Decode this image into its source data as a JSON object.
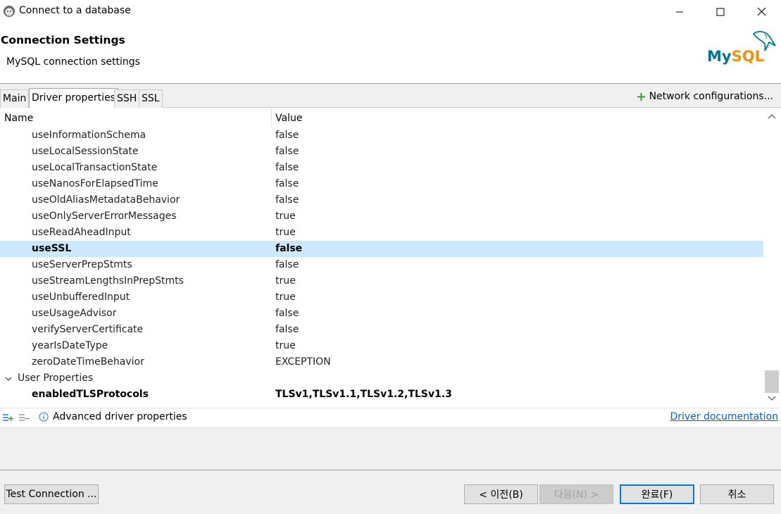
{
  "window": {
    "title": "Connect to a database"
  },
  "header": {
    "title": "Connection Settings",
    "subtitle": "MySQL connection settings",
    "logo_text": "MySQL"
  },
  "tabs": [
    {
      "label": "Main"
    },
    {
      "label": "Driver properties",
      "active": true
    },
    {
      "label": "SSH"
    },
    {
      "label": "SSL"
    }
  ],
  "network_config": {
    "label": "Network configurations..."
  },
  "table": {
    "columns": {
      "name": "Name",
      "value": "Value"
    },
    "rows": [
      {
        "name": "useInformationSchema",
        "value": "false"
      },
      {
        "name": "useLocalSessionState",
        "value": "false"
      },
      {
        "name": "useLocalTransactionState",
        "value": "false"
      },
      {
        "name": "useNanosForElapsedTime",
        "value": "false"
      },
      {
        "name": "useOldAliasMetadataBehavior",
        "value": "false"
      },
      {
        "name": "useOnlyServerErrorMessages",
        "value": "true"
      },
      {
        "name": "useReadAheadInput",
        "value": "true"
      },
      {
        "name": "useSSL",
        "value": "false",
        "selected": true,
        "bold": true
      },
      {
        "name": "useServerPrepStmts",
        "value": "false"
      },
      {
        "name": "useStreamLengthsInPrepStmts",
        "value": "true"
      },
      {
        "name": "useUnbufferedInput",
        "value": "true"
      },
      {
        "name": "useUsageAdvisor",
        "value": "false"
      },
      {
        "name": "verifyServerCertificate",
        "value": "false"
      },
      {
        "name": "yearIsDateType",
        "value": "true"
      },
      {
        "name": "zeroDateTimeBehavior",
        "value": "EXCEPTION"
      }
    ],
    "group": {
      "name": "User Properties",
      "expanded": true
    },
    "user_rows": [
      {
        "name": "enabledTLSProtocols",
        "value": "TLSv1,TLSv1.1,TLSv1.2,TLSv1.3",
        "bold": true
      }
    ]
  },
  "footer": {
    "advanced_label": "Advanced driver properties",
    "driver_doc_link": "Driver documentation"
  },
  "buttons": {
    "test_connection": "Test Connection ...",
    "prev": "< 이전(B)",
    "next": "다음(N) >",
    "finish": "완료(F)",
    "cancel": "취소"
  },
  "colors": {
    "selection": "#cce8ff",
    "link": "#0563c1",
    "accent": "#0078d7",
    "logo_blue": "#00758f",
    "logo_orange": "#f29111"
  },
  "icons": {
    "app": "dbeaver-icon",
    "network_add": "plus-icon",
    "expand_all": "expand-all-icon",
    "collapse_all": "collapse-all-icon",
    "info": "info-icon"
  }
}
